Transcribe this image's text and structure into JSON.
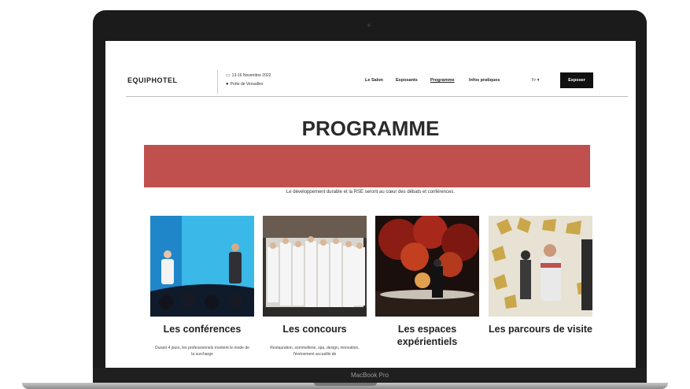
{
  "site": {
    "logo": "EQUIPHOTEL",
    "event_date": "13-16 Novembre 2022",
    "event_place": "Porte de Versailles",
    "menu": [
      "Le Salon",
      "Exposants",
      "Programme",
      "Infos pratiques"
    ],
    "active_menu": "Programme",
    "language": "Fr ▾",
    "cta_label": "Exposer"
  },
  "page": {
    "title": "PROGRAMME",
    "banner_color": "#c0504d",
    "subtitle": "Le développement durable et la RSE seront au cœur des débats et conférences."
  },
  "cards": [
    {
      "title": "Les conférences",
      "desc": "Durant 4 jours, les professionnels montent le mode de la surcharge"
    },
    {
      "title": "Les concours",
      "desc": "Restauration, sommellerie, spa, design, innovation, l'événement accueille de"
    },
    {
      "title": "Les espaces expérientiels",
      "desc": ""
    },
    {
      "title": "Les parcours de visite",
      "desc": ""
    }
  ],
  "device": {
    "label": "MacBook Pro"
  },
  "icons": {
    "calendar": "calendar-icon",
    "location": "location-pin-icon"
  }
}
